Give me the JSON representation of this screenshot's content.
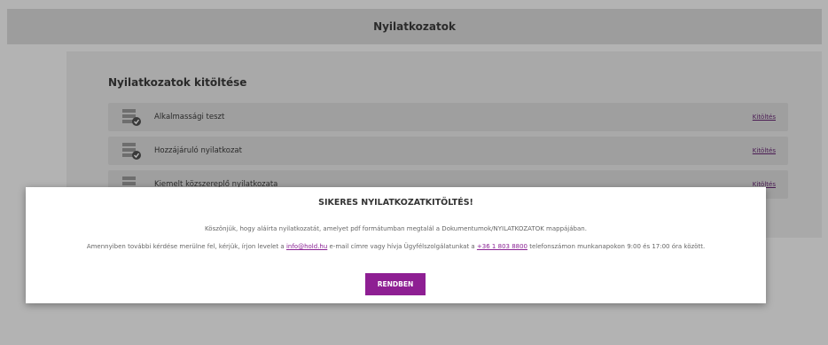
{
  "header": {
    "title": "Nyilatkozatok"
  },
  "section": {
    "title": "Nyilatkozatok kitöltése"
  },
  "rows": [
    {
      "label": "Alkalmassági teszt",
      "link": "Kitöltés"
    },
    {
      "label": "Hozzájáruló nyilatkozat",
      "link": "Kitöltés"
    },
    {
      "label": "Kiemelt közszereplő nyilatkozata",
      "link": "Kitöltés"
    }
  ],
  "modal": {
    "title": "SIKERES NYILATKOZATKITÖLTÉS!",
    "line1": "Köszönjük, hogy aláírta nyilatkozatát, amelyet pdf formátumban megtalál a Dokumentumok/NYILATKOZATOK mappájában.",
    "line2_pre": "Amennyiben további kérdése merülne fel, kérjük, írjon levelet a ",
    "email": "info@hold.hu",
    "line2_mid": " e-mail címre vagy hívja Ügyfélszolgálatunkat a ",
    "phone": "+36 1 803 8800",
    "line2_post": " telefonszámon munkanapokon 9:00 és 17:00 óra között.",
    "ok_label": "RENDBEN"
  },
  "colors": {
    "accent": "#8e1f93",
    "link": "#8a2394"
  }
}
